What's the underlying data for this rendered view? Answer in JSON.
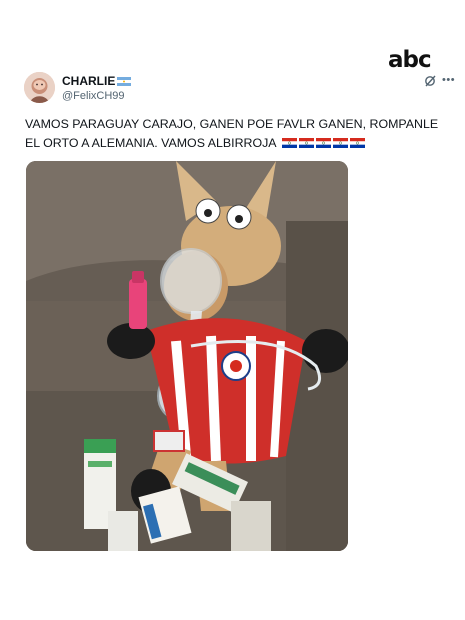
{
  "brand": {
    "logo_text": "abc"
  },
  "tweet": {
    "display_name": "CHARLIE",
    "handle": "@FelixCH99",
    "text": "VAMOS PARAGUAY CARAJO, GANEN POE FAVLR GANEN, ROMPANLE EL ORTO A ALEMANIA.  VAMOS ALBIRROJA",
    "flag_count": 5
  },
  "icons": {
    "avatar": "avatar-illustration",
    "name_flag": "argentina-flag-icon",
    "grok": "grok-icon",
    "more": "more-options-icon",
    "text_flags": "paraguay-flag-icon"
  },
  "colors": {
    "text": "#0f1419",
    "secondary_text": "#536471",
    "paraguay_red": "#d52b1e",
    "paraguay_blue": "#0038a8"
  }
}
